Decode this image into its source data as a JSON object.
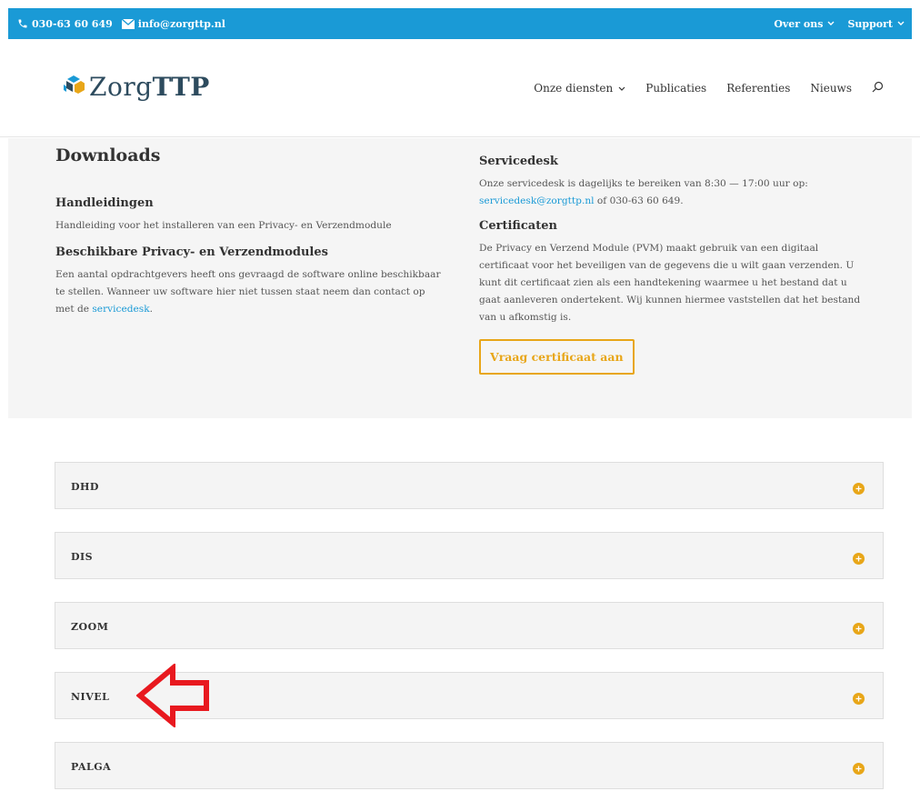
{
  "topbar": {
    "phone": "030-63 60 649",
    "email": "info@zorgttp.nl",
    "menu": [
      {
        "label": "Over ons"
      },
      {
        "label": "Support"
      }
    ],
    "icons": {
      "phone": "phone-icon",
      "email": "envelope-icon"
    }
  },
  "brand": {
    "logo_regular": "Zorg",
    "logo_bold": "TTP",
    "colors": {
      "blue": "#1a9ad6",
      "navy": "#2d4b5e",
      "accent": "#e8a618"
    }
  },
  "nav": {
    "items": [
      {
        "label": "Onze diensten",
        "dropdown": true
      },
      {
        "label": "Publicaties"
      },
      {
        "label": "Referenties"
      },
      {
        "label": "Nieuws"
      }
    ],
    "search_icon": "search-icon"
  },
  "downloads": {
    "title": "Downloads",
    "manuals_heading": "Handleidingen",
    "manuals_text": "Handleiding voor het installeren van een Privacy- en Verzendmodule",
    "modules_heading": "Beschikbare Privacy- en Verzendmodules",
    "modules_text": "Een aantal opdrachtgevers heeft ons gevraagd de software online beschikbaar te stellen. Wanneer uw software hier niet tussen staat neem dan contact op met de",
    "modules_link": "servicedesk",
    "modules_end": "."
  },
  "servicedesk": {
    "heading": "Servicedesk",
    "text_before": "Onze servicedesk is dagelijks te bereiken van 8:30 — 17:00 uur op:",
    "email_link": "servicedesk@zorgttp.nl",
    "text_after": "of 030-63 60 649."
  },
  "certificates": {
    "heading": "Certificaten",
    "text": "De Privacy en Verzend Module (PVM) maakt gebruik van een digitaal certificaat voor het beveiligen van de gegevens die u wilt gaan verzenden. U kunt dit certificaat zien als een handtekening waarmee u het bestand dat u gaat aanleveren ondertekent. Wij kunnen hiermee vaststellen dat het bestand van u afkomstig is.",
    "button": "Vraag certificaat aan"
  },
  "accordion": [
    {
      "label": "DHD"
    },
    {
      "label": "DIS"
    },
    {
      "label": "ZOOM"
    },
    {
      "label": "NIVEL"
    },
    {
      "label": "PALGA"
    }
  ],
  "annotation": {
    "icon": "red-arrow-left-icon",
    "color": "#e8191f"
  }
}
